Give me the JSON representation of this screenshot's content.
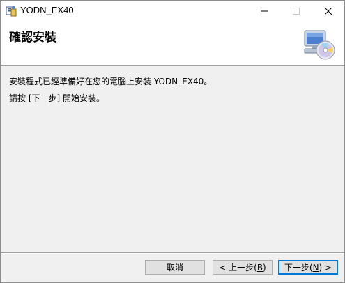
{
  "window": {
    "title": "YODN_EX40",
    "controls": {
      "minimize": "minimize",
      "maximize": "maximize",
      "close": "close"
    }
  },
  "banner": {
    "title": "確認安裝",
    "icon": "computer-cd-icon"
  },
  "body": {
    "line1": "安裝程式已經準備好在您的電腦上安裝 YODN_EX40。",
    "line2": "請按 [下一步] 開始安裝。"
  },
  "buttons": {
    "cancel": "取消",
    "back_prefix": "< 上一步(",
    "back_key": "B",
    "back_suffix": ")",
    "next_prefix": "下一步(",
    "next_key": "N",
    "next_suffix": ") >"
  },
  "colors": {
    "accent": "#0078d7",
    "face": "#f0f0f0",
    "button": "#e1e1e1"
  }
}
